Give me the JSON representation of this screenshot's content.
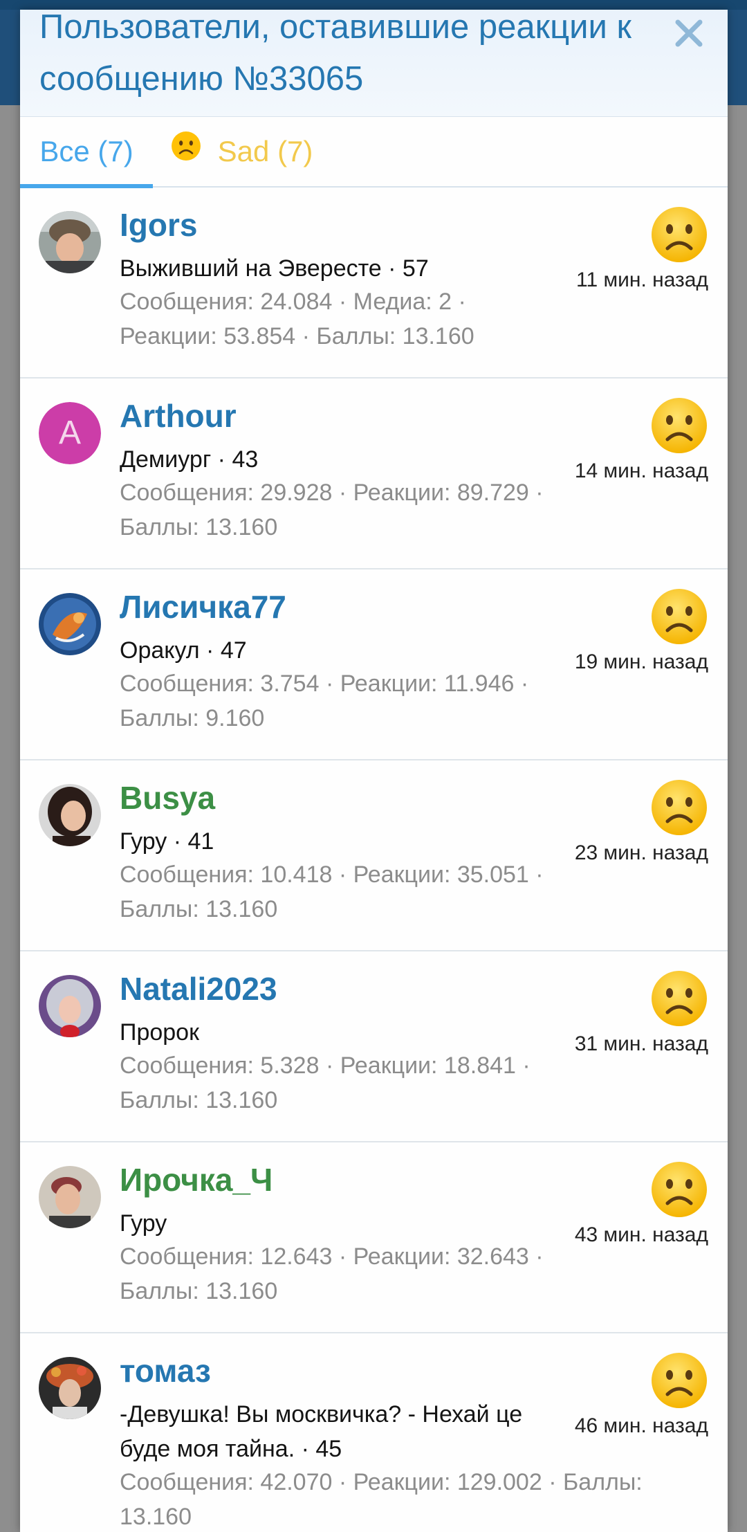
{
  "modal": {
    "title": "Пользователи, оставившие реакции к сообщению №33065",
    "close_icon": "close-icon"
  },
  "tabs": {
    "all_label": "Все (7)",
    "sad_label": "Sad (7)"
  },
  "colors": {
    "link_blue": "#2577b1",
    "tab_active": "#47a7eb",
    "tab_sad": "#f2c94c",
    "username_green": "#3c8f45",
    "muted": "#8c8c8c",
    "emoji_yellow": "#ffc107"
  },
  "users": [
    {
      "name": "Igors",
      "title": "Выживший на Эвересте · 57",
      "stats": "Сообщения: 24.084 · Медиа: 2 · Реакции: 53.854 · Баллы: 13.160",
      "time": "11 мин. назад",
      "avatar": "photo",
      "color": "blue"
    },
    {
      "name": "Arthour",
      "title": "Демиург · 43",
      "stats": "Сообщения: 29.928 · Реакции: 89.729 · Баллы: 13.160",
      "time": "14 мин. назад",
      "avatar": "letter",
      "avatar_letter": "A",
      "color": "blue"
    },
    {
      "name": "Лисичка77",
      "title": "Оракул · 47",
      "stats": "Сообщения: 3.754 · Реакции: 11.946 · Баллы: 9.160",
      "time": "19 мин. назад",
      "avatar": "photo",
      "color": "blue"
    },
    {
      "name": "Busya",
      "title": "Гуру · 41",
      "stats": "Сообщения: 10.418 · Реакции: 35.051 · Баллы: 13.160",
      "time": "23 мин. назад",
      "avatar": "photo",
      "color": "green"
    },
    {
      "name": "Natali2023",
      "title": "Пророк",
      "stats": "Сообщения: 5.328 · Реакции: 18.841 · Баллы: 13.160",
      "time": "31 мин. назад",
      "avatar": "photo",
      "color": "blue"
    },
    {
      "name": "Ирочка_Ч",
      "title": "Гуру",
      "stats": "Сообщения: 12.643 · Реакции: 32.643 · Баллы: 13.160",
      "time": "43 мин. назад",
      "avatar": "photo",
      "color": "green"
    },
    {
      "name": "томаз",
      "title": "-Девушка! Вы москвичка? - Нехай це буде моя тайна. · 45",
      "stats": "Сообщения: 42.070 · Реакции: 129.002 · Баллы: 13.160",
      "time": "46 мин. назад",
      "avatar": "photo",
      "color": "blue"
    }
  ]
}
